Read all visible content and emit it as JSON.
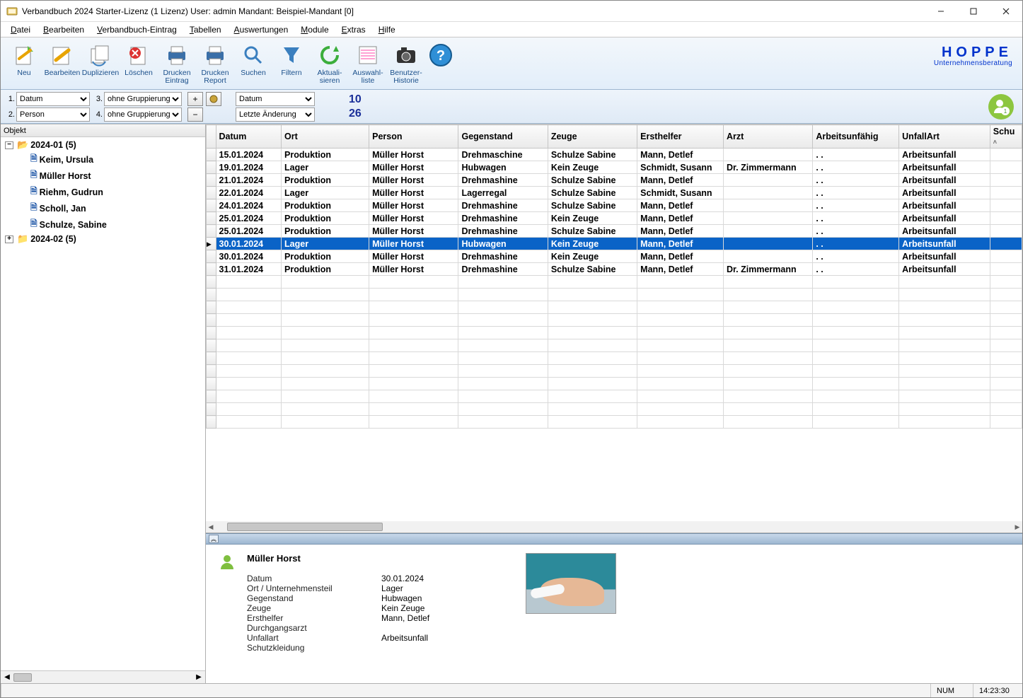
{
  "titlebar": {
    "title": "Verbandbuch 2024 Starter-Lizenz (1 Lizenz)   User: admin Mandant: Beispiel-Mandant [0]"
  },
  "menu": {
    "datei": "Datei",
    "bearbeiten": "Bearbeiten",
    "verbandbuch": "Verbandbuch-Eintrag",
    "tabellen": "Tabellen",
    "auswertungen": "Auswertungen",
    "module": "Module",
    "extras": "Extras",
    "hilfe": "Hilfe"
  },
  "toolbar": {
    "neu": "Neu",
    "bearbeiten": "Bearbeiten",
    "duplizieren": "Duplizieren",
    "loeschen": "Löschen",
    "drucken_eintrag": "Drucken\nEintrag",
    "drucken_report": "Drucken\nReport",
    "suchen": "Suchen",
    "filtern": "Filtern",
    "aktualisieren": "Aktuali-\nsieren",
    "auswahlliste": "Auswahl-\nliste",
    "benutzerhistorie": "Benutzer-\nHistorie",
    "help_icon": "?"
  },
  "logo": {
    "main": "HOPPE",
    "sub": "Unternehmensberatung"
  },
  "groupbar": {
    "lbl1": "1.",
    "sel1": "Datum",
    "lbl2": "2.",
    "sel2": "Person",
    "lbl3": "3.",
    "sel3": "ohne Gruppierung",
    "lbl4": "4.",
    "sel4": "ohne Gruppierung",
    "plus": "+",
    "minus": "−",
    "sort1": "Datum",
    "sort2": "Letzte Änderung",
    "count1": "10",
    "count2": "26",
    "badge": "1"
  },
  "tree": {
    "header": "Objekt",
    "n1": {
      "exp": "−",
      "label": "2024-01  (5)"
    },
    "leaves": [
      "Keim, Ursula",
      "Müller Horst",
      "Riehm, Gudrun",
      "Scholl, Jan",
      "Schulze, Sabine"
    ],
    "n2": {
      "exp": "+",
      "label": "2024-02  (5)"
    }
  },
  "table": {
    "cols": [
      "Datum",
      "Ort",
      "Person",
      "Gegenstand",
      "Zeuge",
      "Ersthelfer",
      "Arzt",
      "Arbeitsunfähig",
      "UnfallArt",
      "Schu"
    ],
    "rows": [
      {
        "d": "15.01.2024",
        "o": "Produktion",
        "p": "Müller Horst",
        "g": "Drehmaschine",
        "z": "Schulze Sabine",
        "e": "Mann, Detlef",
        "a": "",
        "au": "  .  .",
        "u": "Arbeitsunfall"
      },
      {
        "d": "19.01.2024",
        "o": "Lager",
        "p": "Müller Horst",
        "g": "Hubwagen",
        "z": "Kein Zeuge",
        "e": "Schmidt, Susann",
        "a": "Dr. Zimmermann",
        "au": "  .  .",
        "u": "Arbeitsunfall"
      },
      {
        "d": "21.01.2024",
        "o": "Produktion",
        "p": "Müller Horst",
        "g": "Drehmashine",
        "z": "Schulze Sabine",
        "e": "Mann, Detlef",
        "a": "",
        "au": "  .  .",
        "u": "Arbeitsunfall"
      },
      {
        "d": "22.01.2024",
        "o": "Lager",
        "p": "Müller Horst",
        "g": "Lagerregal",
        "z": "Schulze Sabine",
        "e": "Schmidt, Susann",
        "a": "",
        "au": "  .  .",
        "u": "Arbeitsunfall"
      },
      {
        "d": "24.01.2024",
        "o": "Produktion",
        "p": "Müller Horst",
        "g": "Drehmashine",
        "z": "Schulze Sabine",
        "e": "Mann, Detlef",
        "a": "",
        "au": "  .  .",
        "u": "Arbeitsunfall"
      },
      {
        "d": "25.01.2024",
        "o": "Produktion",
        "p": "Müller Horst",
        "g": "Drehmashine",
        "z": "Kein Zeuge",
        "e": "Mann, Detlef",
        "a": "",
        "au": "  .  .",
        "u": "Arbeitsunfall"
      },
      {
        "d": "25.01.2024",
        "o": "Produktion",
        "p": "Müller Horst",
        "g": "Drehmashine",
        "z": "Schulze Sabine",
        "e": "Mann, Detlef",
        "a": "",
        "au": "  .  .",
        "u": "Arbeitsunfall"
      },
      {
        "d": "30.01.2024",
        "o": "Lager",
        "p": "Müller Horst",
        "g": "Hubwagen",
        "z": "Kein Zeuge",
        "e": "Mann, Detlef",
        "a": "",
        "au": "  .  .",
        "u": "Arbeitsunfall",
        "sel": true
      },
      {
        "d": "30.01.2024",
        "o": "Produktion",
        "p": "Müller Horst",
        "g": "Drehmashine",
        "z": "Kein Zeuge",
        "e": "Mann, Detlef",
        "a": "",
        "au": "  .  .",
        "u": "Arbeitsunfall"
      },
      {
        "d": "31.01.2024",
        "o": "Produktion",
        "p": "Müller Horst",
        "g": "Drehmashine",
        "z": "Schulze Sabine",
        "e": "Mann, Detlef",
        "a": "Dr. Zimmermann",
        "au": "  .  .",
        "u": "Arbeitsunfall"
      }
    ]
  },
  "detail": {
    "name": "Müller Horst",
    "rows": [
      {
        "k": "Datum",
        "v": "30.01.2024"
      },
      {
        "k": "Ort / Unternehmensteil",
        "v": "Lager"
      },
      {
        "k": "Gegenstand",
        "v": "Hubwagen"
      },
      {
        "k": "Zeuge",
        "v": "Kein Zeuge"
      },
      {
        "k": "Ersthelfer",
        "v": "Mann, Detlef"
      },
      {
        "k": "Durchgangsarzt",
        "v": ""
      },
      {
        "k": "Unfallart",
        "v": "Arbeitsunfall"
      },
      {
        "k": "Schutzkleidung",
        "v": ""
      }
    ]
  },
  "status": {
    "num": "NUM",
    "time": "14:23:30"
  }
}
